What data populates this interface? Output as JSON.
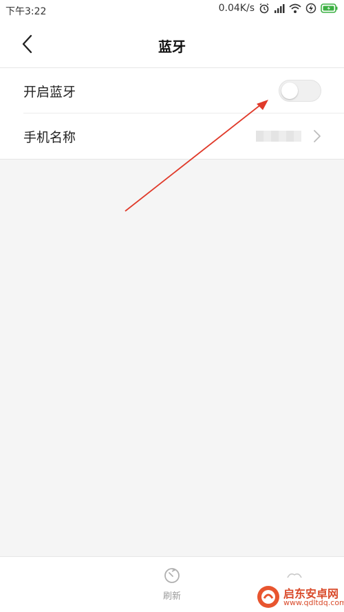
{
  "status_bar": {
    "time": "下午3:22",
    "network_speed": "0.04K/s",
    "icons": [
      "alarm-icon",
      "signal-icon",
      "wifi-icon",
      "charging-icon",
      "battery-icon"
    ]
  },
  "header": {
    "title": "蓝牙",
    "back_icon": "chevron-left-icon"
  },
  "settings": {
    "bluetooth_label": "开启蓝牙",
    "bluetooth_enabled": false,
    "device_name_label": "手机名称",
    "device_name_value": "██████"
  },
  "bottom_bar": {
    "refresh_label": "刷新",
    "refresh_icon": "refresh-icon",
    "more_icon": "more-icon"
  },
  "watermark": {
    "name": "启东安卓网",
    "url": "www.qdltdq.com"
  },
  "colors": {
    "background": "#f5f5f5",
    "surface": "#ffffff",
    "annotation_arrow": "#e03a2a",
    "watermark": "#d94a2a"
  }
}
